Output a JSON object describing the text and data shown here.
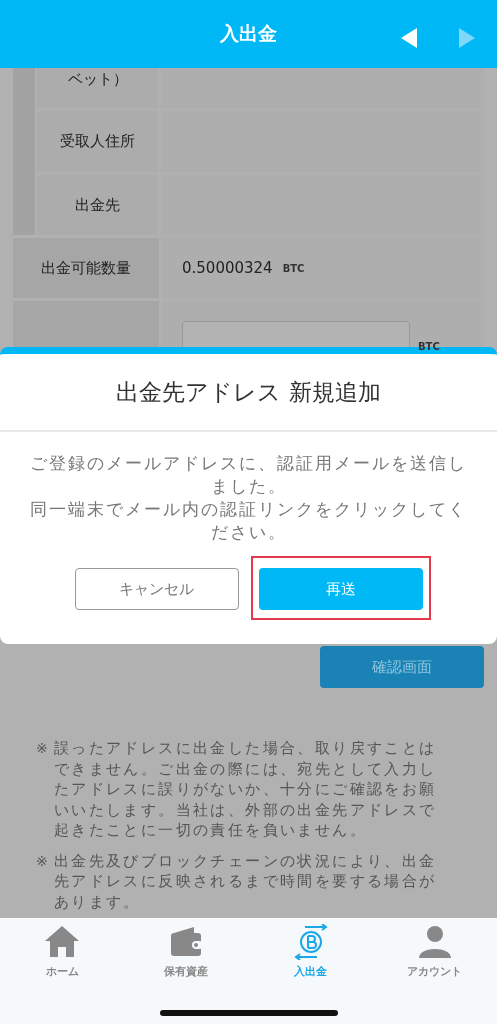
{
  "header": {
    "title": "入出金",
    "nav": [
      {
        "kind": "back",
        "disabled": false
      },
      {
        "kind": "forward",
        "disabled": true
      }
    ]
  },
  "address_group": {
    "rows": [
      {
        "label": "ベット）"
      },
      {
        "label": "受取人住所"
      },
      {
        "label": "出金先"
      }
    ]
  },
  "available": {
    "label": "出金可能数量",
    "value": "0.50000324",
    "unit": "BTC"
  },
  "amount": {
    "unit": "BTC"
  },
  "confirm_button": "確認画面",
  "notes": [
    {
      "mark": "※",
      "text": "誤ったアドレスに出金した場合、取り戻すことはできません。ご出金の際には、宛先として入力したアドレスに誤りがないか、十分にご確認をお願いいたします。当社は、外部の出金先アドレスで起きたことに一切の責任を負いません。"
    },
    {
      "mark": "※",
      "text": "出金先及びブロックチェーンの状況により、出金先アドレスに反映されるまで時間を要する場合があります。"
    }
  ],
  "dialog": {
    "title": "出金先アドレス 新規追加",
    "message": [
      "ご登録のメールアドレスに、認証用メールを送信しました。",
      "同一端末でメール内の認証リンクをクリックしてください。"
    ],
    "buttons": [
      {
        "label": "キャンセル",
        "kind": "secondary",
        "highlighted": false
      },
      {
        "label": "再送",
        "kind": "primary",
        "highlighted": true
      }
    ]
  },
  "tab_bar": [
    {
      "label": "ホーム",
      "selected": false
    },
    {
      "label": "保有資産",
      "selected": false
    },
    {
      "label": "入出金",
      "selected": true
    },
    {
      "label": "アカウント",
      "selected": false
    }
  ]
}
